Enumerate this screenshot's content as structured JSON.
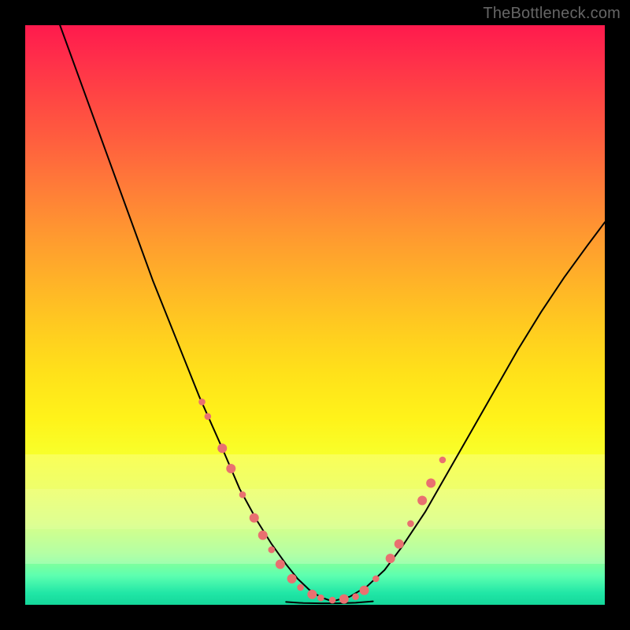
{
  "watermark": "TheBottleneck.com",
  "chart_data": {
    "type": "line",
    "title": "",
    "xlabel": "",
    "ylabel": "",
    "xlim": [
      0,
      100
    ],
    "ylim": [
      0,
      100
    ],
    "grid": false,
    "legend": false,
    "series": [
      {
        "name": "left-curve",
        "stroke": "#000000",
        "x": [
          6,
          10,
          14,
          18,
          22,
          26,
          30,
          34,
          37,
          40,
          42.5,
          45,
          47,
          49,
          51,
          53
        ],
        "y": [
          100,
          89,
          78,
          67,
          56,
          46,
          36,
          27,
          20,
          14.5,
          10.5,
          7,
          4.5,
          2.6,
          1.3,
          0.6
        ]
      },
      {
        "name": "right-curve",
        "stroke": "#000000",
        "x": [
          53,
          56,
          59,
          62,
          65,
          69,
          73,
          77,
          81,
          85,
          89,
          93,
          97,
          100
        ],
        "y": [
          0.6,
          1.4,
          3.2,
          6,
          10,
          16,
          23,
          30,
          37,
          44,
          50.5,
          56.5,
          62,
          66
        ]
      },
      {
        "name": "bottom-flat",
        "stroke": "#000000",
        "x": [
          45,
          48,
          51,
          54,
          57,
          60
        ],
        "y": [
          0.5,
          0.3,
          0.25,
          0.25,
          0.35,
          0.6
        ]
      }
    ],
    "markers": {
      "name": "salmon-dots",
      "color": "#e97070",
      "r_small": 4.3,
      "r_large": 6.0,
      "points": [
        {
          "x": 30.5,
          "y": 35,
          "r": "small"
        },
        {
          "x": 31.5,
          "y": 32.5,
          "r": "small"
        },
        {
          "x": 34.0,
          "y": 27.0,
          "r": "large"
        },
        {
          "x": 35.5,
          "y": 23.5,
          "r": "large"
        },
        {
          "x": 37.5,
          "y": 19.0,
          "r": "small"
        },
        {
          "x": 39.5,
          "y": 15.0,
          "r": "large"
        },
        {
          "x": 41.0,
          "y": 12.0,
          "r": "large"
        },
        {
          "x": 42.5,
          "y": 9.5,
          "r": "small"
        },
        {
          "x": 44.0,
          "y": 7.0,
          "r": "large"
        },
        {
          "x": 46.0,
          "y": 4.5,
          "r": "large"
        },
        {
          "x": 47.5,
          "y": 3.0,
          "r": "small"
        },
        {
          "x": 49.5,
          "y": 1.8,
          "r": "large"
        },
        {
          "x": 51.0,
          "y": 1.2,
          "r": "small"
        },
        {
          "x": 53.0,
          "y": 0.8,
          "r": "small"
        },
        {
          "x": 55.0,
          "y": 1.0,
          "r": "large"
        },
        {
          "x": 57.0,
          "y": 1.4,
          "r": "small"
        },
        {
          "x": 58.5,
          "y": 2.5,
          "r": "large"
        },
        {
          "x": 60.5,
          "y": 4.5,
          "r": "small"
        },
        {
          "x": 63.0,
          "y": 8.0,
          "r": "large"
        },
        {
          "x": 64.5,
          "y": 10.5,
          "r": "large"
        },
        {
          "x": 66.5,
          "y": 14.0,
          "r": "small"
        },
        {
          "x": 68.5,
          "y": 18.0,
          "r": "large"
        },
        {
          "x": 70.0,
          "y": 21.0,
          "r": "large"
        },
        {
          "x": 72.0,
          "y": 25.0,
          "r": "small"
        }
      ]
    },
    "colors": {
      "gradient_top": "#ff1a4d",
      "gradient_mid": "#ffe11a",
      "gradient_bottom": "#14d79a",
      "curve": "#000000",
      "marker": "#e97070",
      "frame": "#000000"
    }
  }
}
